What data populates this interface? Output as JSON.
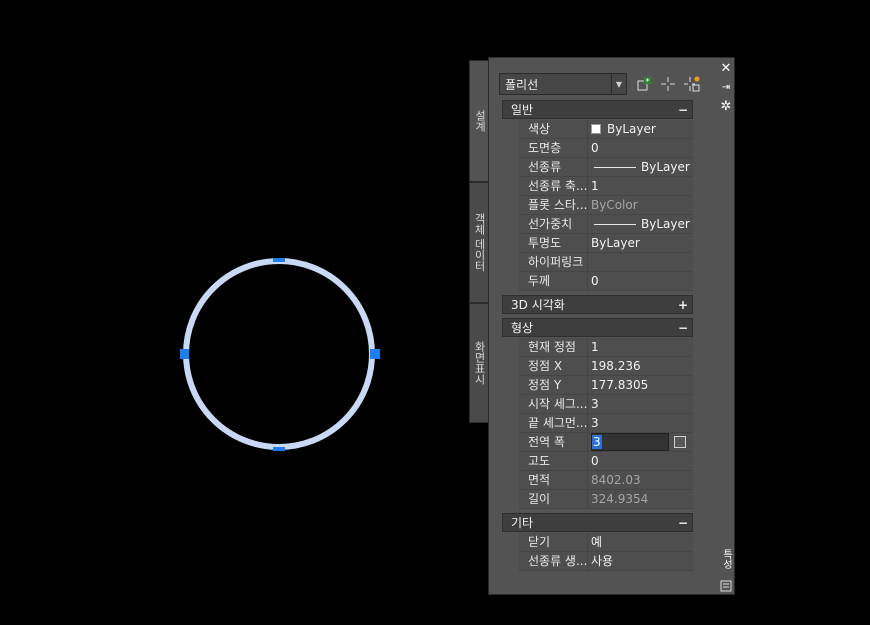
{
  "palette": {
    "object_type": "폴리선",
    "side_tabs": [
      "설계",
      "객체 데이터",
      "화면표시"
    ],
    "right_labels": {
      "bottom": "특성"
    }
  },
  "sections": {
    "general": {
      "title": "일반",
      "toggle": "−",
      "rows": [
        {
          "label": "색상",
          "value": "ByLayer"
        },
        {
          "label": "도면층",
          "value": "0"
        },
        {
          "label": "선종류",
          "value": "ByLayer"
        },
        {
          "label": "선종류 축...",
          "value": "1"
        },
        {
          "label": "플롯 스타...",
          "value": "ByColor"
        },
        {
          "label": "선가중치",
          "value": "ByLayer"
        },
        {
          "label": "투명도",
          "value": "ByLayer"
        },
        {
          "label": "하이퍼링크",
          "value": ""
        },
        {
          "label": "두께",
          "value": "0"
        }
      ]
    },
    "visual3d": {
      "title": "3D 시각화",
      "toggle": "+"
    },
    "geometry": {
      "title": "형상",
      "toggle": "−",
      "rows": [
        {
          "label": "현재 정점",
          "value": "1"
        },
        {
          "label": "정점 X",
          "value": "198.236"
        },
        {
          "label": "정점 Y",
          "value": "177.8305"
        },
        {
          "label": "시작 세그...",
          "value": "3"
        },
        {
          "label": "끝 세그먼...",
          "value": "3"
        },
        {
          "label": "전역 폭",
          "value": "3"
        },
        {
          "label": "고도",
          "value": "0"
        },
        {
          "label": "면적",
          "value": "8402.03"
        },
        {
          "label": "길이",
          "value": "324.9354"
        }
      ]
    },
    "misc": {
      "title": "기타",
      "toggle": "−",
      "rows": [
        {
          "label": "닫기",
          "value": "예"
        },
        {
          "label": "선종류 생...",
          "value": "사용"
        }
      ]
    }
  },
  "colors": {
    "circle": "#c9d9f5",
    "grip": "#1e7ef0",
    "background": "#000000",
    "palette_bg": "#535353"
  }
}
